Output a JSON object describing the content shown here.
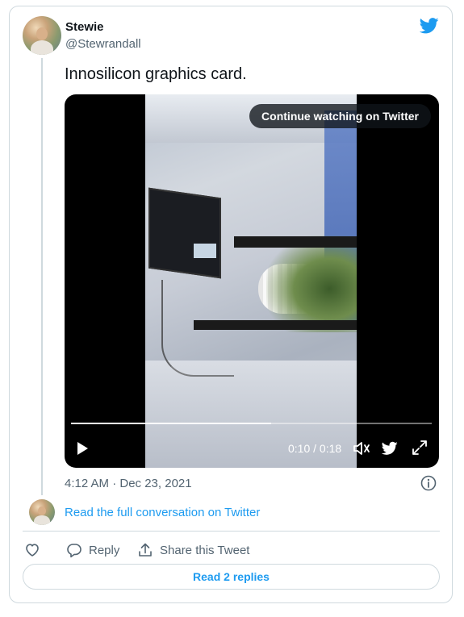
{
  "author": {
    "name": "Stewie",
    "handle": "@Stewrandall"
  },
  "tweet": {
    "text": "Innosilicon graphics card.",
    "timestamp": "4:12 AM · Dec 23, 2021"
  },
  "video": {
    "overlay_label": "Continue watching on Twitter",
    "time_display": "0:10 / 0:18",
    "progress": 0.555
  },
  "conversation": {
    "link_label": "Read the full conversation on Twitter"
  },
  "actions": {
    "reply_label": "Reply",
    "share_label": "Share this Tweet",
    "read_replies_label": "Read 2 replies"
  },
  "colors": {
    "accent": "#1d9bf0",
    "muted_text": "#536471",
    "border": "#cfd9de"
  },
  "icons": [
    "twitter-bird-icon",
    "play-icon",
    "volume-icon",
    "fullscreen-icon",
    "info-icon",
    "heart-icon",
    "reply-icon",
    "share-icon"
  ]
}
